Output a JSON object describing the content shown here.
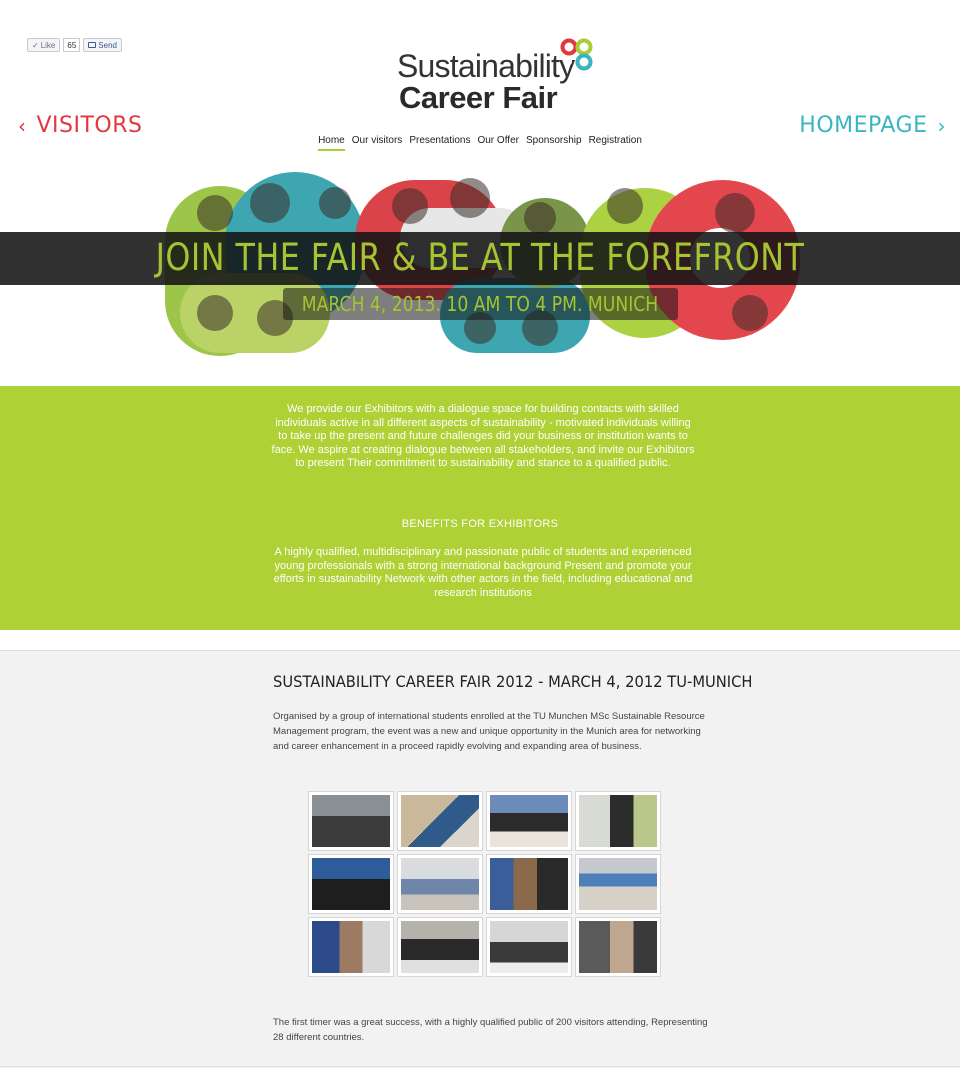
{
  "social": {
    "like_label": "Like",
    "like_count": "65",
    "send_label": "Send"
  },
  "logo": {
    "line1": "Sustainability",
    "line2": "Career Fair"
  },
  "side_nav": {
    "left_label": "VISITORS",
    "right_label": "HOMEPAGE"
  },
  "nav": {
    "items": [
      {
        "label": "Home",
        "active": true
      },
      {
        "label": "Our visitors",
        "active": false
      },
      {
        "label": "Presentations",
        "active": false
      },
      {
        "label": "Our Offer",
        "active": false
      },
      {
        "label": "Sponsorship",
        "active": false
      },
      {
        "label": "Registration",
        "active": false
      }
    ]
  },
  "hero": {
    "title": "JOIN THE FAIR & BE AT THE FOREFRONT",
    "subtitle": "MARCH 4, 2013. 10 AM TO 4 PM. MUNICH"
  },
  "exhibitors": {
    "intro": "We provide our Exhibitors with a dialogue space for building contacts with skilled individuals active in all different aspects of sustainability - motivated individuals willing to take up the present and future challenges did your business or institution wants to face. We aspire at creating dialogue between all stakeholders, and invite our Exhibitors to present Their commitment to sustainability and stance to a qualified public.",
    "benefits_heading": "BENEFITS FOR EXHIBITORS",
    "benefits_text": "A highly qualified, multidisciplinary and passionate public of students and experienced young professionals with a strong international background Present and promote your efforts in sustainability Network with other actors in the field, including educational and research institutions"
  },
  "fair2012": {
    "heading": "SUSTAINABILITY CAREER FAIR 2012 - MARCH 4, 2012 TU-MUNICH",
    "description": "Organised by a group of international students enrolled at the TU Munchen MSc Sustainable Resource Management program, the event was a new and unique opportunity in the Munich area for networking and career enhancement in a proceed rapidly evolving and expanding area of business.",
    "footer": "The first timer was a great success, with a highly qualified public of 200 visitors attending, Representing 28 different countries."
  },
  "colors": {
    "brand_green": "#aed136",
    "brand_red": "#e2373f",
    "brand_teal": "#3ab5c0",
    "hero_text": "#a6c332"
  }
}
